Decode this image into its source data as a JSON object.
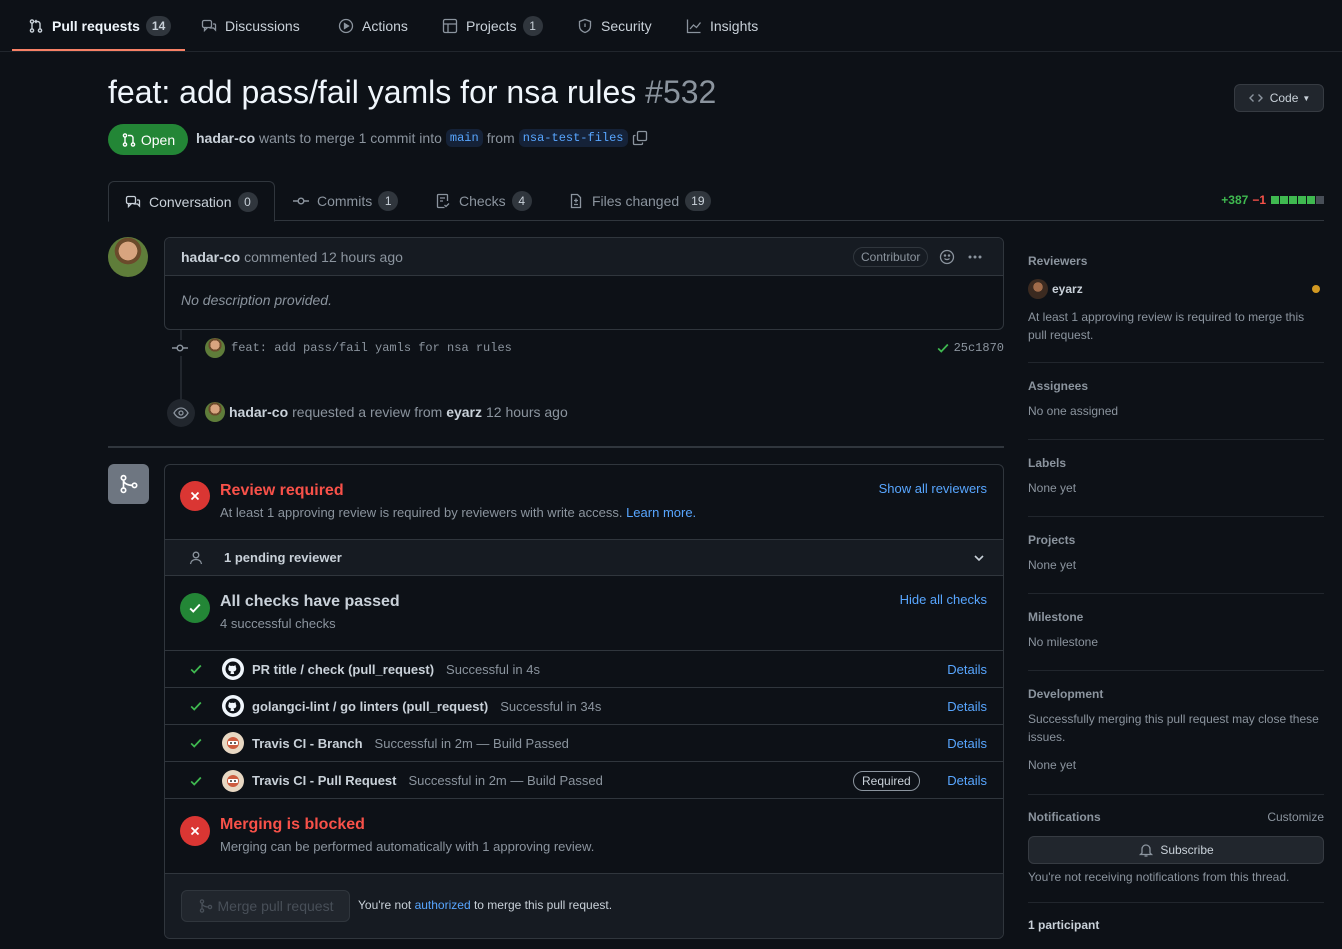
{
  "nav": {
    "items": [
      {
        "label": "Pull requests",
        "count": "14"
      },
      {
        "label": "Discussions"
      },
      {
        "label": "Actions"
      },
      {
        "label": "Projects",
        "count": "1"
      },
      {
        "label": "Security"
      },
      {
        "label": "Insights"
      }
    ]
  },
  "pr": {
    "title": "feat: add pass/fail yamls for nsa rules",
    "number": "#532",
    "state": "Open",
    "author": "hadar-co",
    "merge_text_1": "wants to merge 1 commit into",
    "base_branch": "main",
    "from_text": "from",
    "head_branch": "nsa-test-files",
    "code_button": "Code"
  },
  "tabs": [
    {
      "label": "Conversation",
      "count": "0"
    },
    {
      "label": "Commits",
      "count": "1"
    },
    {
      "label": "Checks",
      "count": "4"
    },
    {
      "label": "Files changed",
      "count": "19"
    }
  ],
  "diffstat": {
    "additions": "+387",
    "deletions": "−1"
  },
  "comment": {
    "author": "hadar-co",
    "action": "commented 12 hours ago",
    "badge": "Contributor",
    "body": "No description provided."
  },
  "commit": {
    "message": "feat: add pass/fail yamls for nsa rules",
    "sha": "25c1870"
  },
  "review_event": {
    "actor": "hadar-co",
    "text": "requested a review from",
    "reviewer": "eyarz",
    "time": "12 hours ago"
  },
  "merge": {
    "review": {
      "title": "Review required",
      "desc": "At least 1 approving review is required by reviewers with write access.",
      "learn": "Learn more.",
      "action": "Show all reviewers"
    },
    "pending": "1 pending reviewer",
    "checks": {
      "title": "All checks have passed",
      "desc": "4 successful checks",
      "action": "Hide all checks"
    },
    "check_rows": [
      {
        "name": "PR title / check (pull_request)",
        "desc": "Successful in 4s",
        "details": "Details",
        "icon": "github-icon"
      },
      {
        "name": "golangci-lint / go linters (pull_request)",
        "desc": "Successful in 34s",
        "details": "Details",
        "icon": "github-icon"
      },
      {
        "name": "Travis CI - Branch",
        "desc": "Successful in 2m — Build Passed",
        "details": "Details",
        "icon": "travis-icon"
      },
      {
        "name": "Travis CI - Pull Request",
        "desc": "Successful in 2m — Build Passed",
        "details": "Details",
        "required": "Required",
        "icon": "travis-icon"
      }
    ],
    "blocked": {
      "title": "Merging is blocked",
      "desc": "Merging can be performed automatically with 1 approving review."
    },
    "button": "Merge pull request",
    "notice_1": "You're not",
    "notice_link": "authorized",
    "notice_2": "to merge this pull request."
  },
  "sidebar": {
    "reviewers": {
      "title": "Reviewers",
      "name": "eyarz",
      "note": "At least 1 approving review is required to merge this pull request."
    },
    "assignees": {
      "title": "Assignees",
      "value": "No one assigned"
    },
    "labels": {
      "title": "Labels",
      "value": "None yet"
    },
    "projects": {
      "title": "Projects",
      "value": "None yet"
    },
    "milestone": {
      "title": "Milestone",
      "value": "No milestone"
    },
    "development": {
      "title": "Development",
      "note": "Successfully merging this pull request may close these issues.",
      "value": "None yet"
    },
    "notifications": {
      "title": "Notifications",
      "customize": "Customize",
      "button": "Subscribe",
      "note": "You're not receiving notifications from this thread."
    },
    "participants": "1 participant"
  },
  "colors": {
    "accent": "#58a6ff",
    "success": "#238636",
    "danger": "#da3633",
    "nav_underline": "#f78166"
  }
}
